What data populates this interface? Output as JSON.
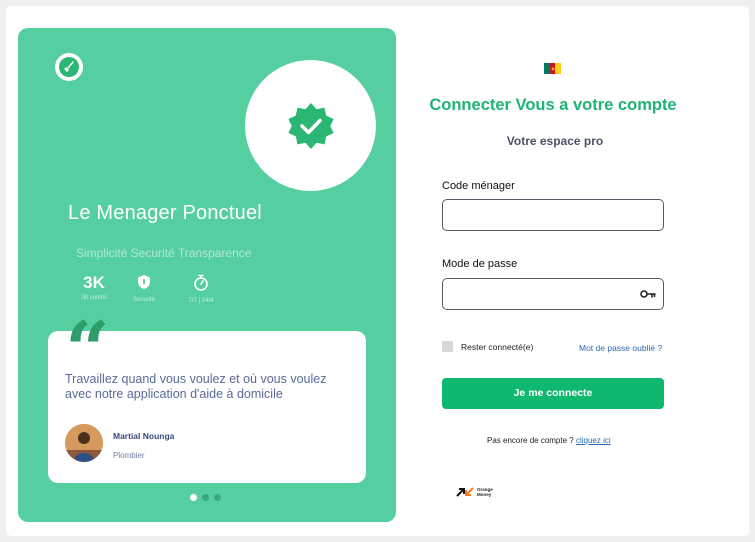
{
  "hero": {
    "logo_icon": "broom-icon",
    "badge_icon": "verified-check-badge-icon",
    "title": "Le Menager Ponctuel",
    "tagline": "Simplicité Securité Transparence",
    "stats": [
      {
        "value": "3K",
        "label": "Jilt comits",
        "icon": ""
      },
      {
        "value": "",
        "label": "Securité",
        "icon": "shield-icon"
      },
      {
        "value": "",
        "label": "7/7 | 24/4",
        "icon": "stopwatch-icon"
      }
    ],
    "quote_mark": "“",
    "testimonial": {
      "text": "Travaillez quand vous voulez et où vous voulez avec notre application d'aide à domicile",
      "author": "Martial Nounga",
      "role": "Plombier"
    },
    "slides": {
      "count": 3,
      "active": 0
    },
    "colors": {
      "panel": "#55cf9f",
      "accent": "#2f9d6a"
    }
  },
  "login": {
    "flag_colors": [
      "#007a5e",
      "#ce1126",
      "#fcd116"
    ],
    "title": "Connecter Vous a votre compte",
    "subtitle": "Votre espace pro",
    "code_label": "Code ménager",
    "code_value": "",
    "password_label": "Mode de passe",
    "password_value": "",
    "password_toggle_icon": "key-icon",
    "remember_label": "Rester connecté(e)",
    "remember_checked": false,
    "forgot_link": "Mot de passe oublié ?",
    "submit_label": "Je me connecte",
    "signup_text": "Pas encore de compte ?",
    "signup_link": "cliquez ici",
    "payment_logo_text": "Orange Money",
    "colors": {
      "primary": "#10b76f",
      "title": "#1eb574",
      "link": "#2d6bb3"
    }
  }
}
